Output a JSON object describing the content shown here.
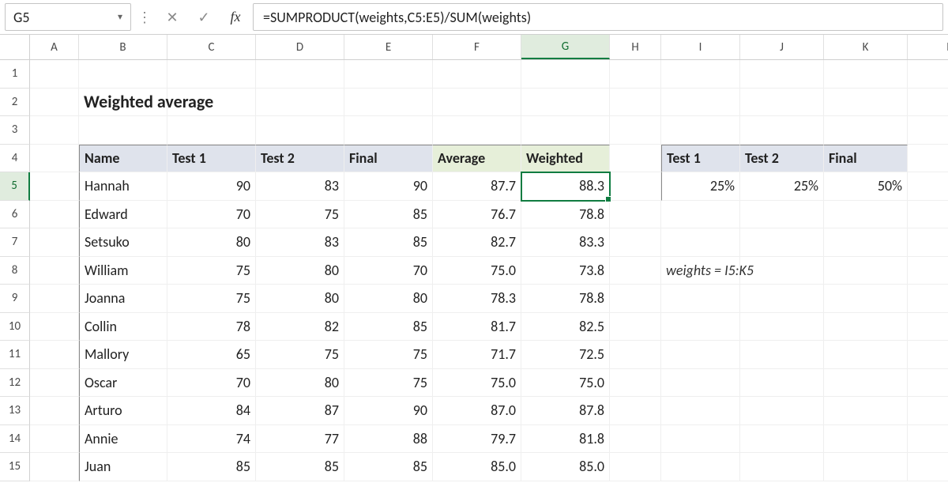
{
  "name_box": "G5",
  "formula": "=SUMPRODUCT(weights,C5:E5)/SUM(weights)",
  "fx_label": "fx",
  "columns": [
    "A",
    "B",
    "C",
    "D",
    "E",
    "F",
    "G",
    "H",
    "I",
    "J",
    "K",
    "L"
  ],
  "active_col": "G",
  "row_labels": [
    "1",
    "2",
    "3",
    "4",
    "5",
    "6",
    "7",
    "8",
    "9",
    "10",
    "11",
    "12",
    "13",
    "14",
    "15"
  ],
  "active_row": "5",
  "title": "Weighted average",
  "note": "weights = I5:K5",
  "main_table": {
    "headers": [
      "Name",
      "Test 1",
      "Test 2",
      "Final",
      "Average",
      "Weighted"
    ],
    "rows": [
      {
        "name": "Hannah",
        "t1": "90",
        "t2": "83",
        "final": "90",
        "avg": "87.7",
        "w": "88.3"
      },
      {
        "name": "Edward",
        "t1": "70",
        "t2": "75",
        "final": "85",
        "avg": "76.7",
        "w": "78.8"
      },
      {
        "name": "Setsuko",
        "t1": "80",
        "t2": "83",
        "final": "85",
        "avg": "82.7",
        "w": "83.3"
      },
      {
        "name": "William",
        "t1": "75",
        "t2": "80",
        "final": "70",
        "avg": "75.0",
        "w": "73.8"
      },
      {
        "name": "Joanna",
        "t1": "75",
        "t2": "80",
        "final": "80",
        "avg": "78.3",
        "w": "78.8"
      },
      {
        "name": "Collin",
        "t1": "78",
        "t2": "82",
        "final": "85",
        "avg": "81.7",
        "w": "82.5"
      },
      {
        "name": "Mallory",
        "t1": "65",
        "t2": "75",
        "final": "75",
        "avg": "71.7",
        "w": "72.5"
      },
      {
        "name": "Oscar",
        "t1": "70",
        "t2": "80",
        "final": "75",
        "avg": "75.0",
        "w": "75.0"
      },
      {
        "name": "Arturo",
        "t1": "84",
        "t2": "87",
        "final": "90",
        "avg": "87.0",
        "w": "87.8"
      },
      {
        "name": "Annie",
        "t1": "74",
        "t2": "77",
        "final": "88",
        "avg": "79.7",
        "w": "81.8"
      },
      {
        "name": "Juan",
        "t1": "85",
        "t2": "85",
        "final": "85",
        "avg": "85.0",
        "w": "85.0"
      }
    ]
  },
  "weights_table": {
    "headers": [
      "Test 1",
      "Test 2",
      "Final"
    ],
    "values": [
      "25%",
      "25%",
      "50%"
    ]
  },
  "chart_data": {
    "type": "table",
    "title": "Weighted average",
    "columns": [
      "Name",
      "Test 1",
      "Test 2",
      "Final",
      "Average",
      "Weighted"
    ],
    "rows": [
      [
        "Hannah",
        90,
        83,
        90,
        87.7,
        88.3
      ],
      [
        "Edward",
        70,
        75,
        85,
        76.7,
        78.8
      ],
      [
        "Setsuko",
        80,
        83,
        85,
        82.7,
        83.3
      ],
      [
        "William",
        75,
        80,
        70,
        75.0,
        73.8
      ],
      [
        "Joanna",
        75,
        80,
        80,
        78.3,
        78.8
      ],
      [
        "Collin",
        78,
        82,
        85,
        81.7,
        82.5
      ],
      [
        "Mallory",
        65,
        75,
        75,
        71.7,
        72.5
      ],
      [
        "Oscar",
        70,
        80,
        75,
        75.0,
        75.0
      ],
      [
        "Arturo",
        84,
        87,
        90,
        87.0,
        87.8
      ],
      [
        "Annie",
        74,
        77,
        88,
        79.7,
        81.8
      ],
      [
        "Juan",
        85,
        85,
        85,
        85.0,
        85.0
      ]
    ],
    "weights": {
      "Test 1": 0.25,
      "Test 2": 0.25,
      "Final": 0.5
    },
    "formula": "=SUMPRODUCT(weights,C5:E5)/SUM(weights)"
  }
}
